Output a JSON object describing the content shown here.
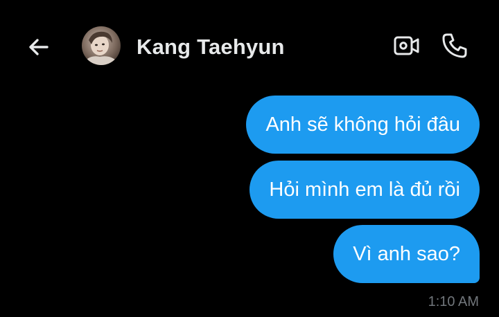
{
  "header": {
    "contact_name": "Kang Taehyun",
    "back_icon": "arrow-left-icon",
    "video_icon": "video-camera-icon",
    "call_icon": "phone-icon"
  },
  "conversation": {
    "messages": [
      {
        "text": "Anh sẽ không hỏi đâu",
        "sender": "me"
      },
      {
        "text": "Hỏi mình em là đủ rồi",
        "sender": "me"
      },
      {
        "text": "Vì anh sao?",
        "sender": "me"
      }
    ],
    "timestamp": "1:10 AM"
  },
  "colors": {
    "background": "#000000",
    "bubble": "#1d9bf0",
    "bubble_text": "#ffffff",
    "primary_text": "#e7e9ea",
    "muted_text": "#71767b"
  }
}
